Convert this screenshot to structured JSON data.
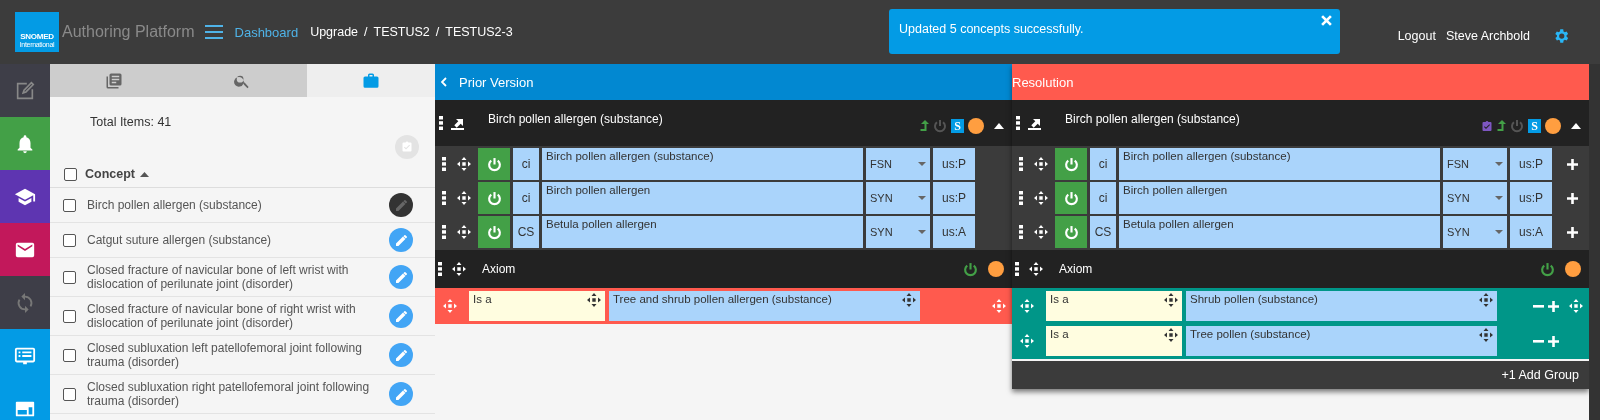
{
  "header": {
    "logo": {
      "name": "SNOMED",
      "subtitle": "International"
    },
    "app_title": "Authoring Platform",
    "nav_link": "Dashboard",
    "breadcrumb": {
      "separator": "/",
      "items": [
        "Upgrade",
        "TESTUS2",
        "TESTUS2-3"
      ]
    },
    "toast": {
      "message": "Updated 5 concepts successfully."
    },
    "logout": "Logout",
    "user": "Steve Archbold"
  },
  "side_nav": [
    {
      "kind": "edit",
      "color": "#3e3e48"
    },
    {
      "kind": "notifications",
      "color": "#43a047"
    },
    {
      "kind": "training",
      "color": "#5e35b1"
    },
    {
      "kind": "messages",
      "color": "#c2185b"
    },
    {
      "kind": "sync",
      "color": "#3e3e48"
    },
    {
      "kind": "list",
      "color": "#039be5"
    },
    {
      "kind": "layout",
      "color": "#039be5"
    }
  ],
  "left_panel": {
    "tabs": [
      {
        "kind": "documents",
        "selected": false
      },
      {
        "kind": "search",
        "selected": false
      },
      {
        "kind": "saved",
        "selected": true
      }
    ],
    "total_items": "Total Items: 41",
    "column": {
      "label": "Concept",
      "sort_ascending": true
    },
    "all_checked": false,
    "rows": [
      {
        "label": "Birch pollen allergen (substance)",
        "checked": false,
        "current": true
      },
      {
        "label": "Catgut suture allergen (substance)",
        "checked": false,
        "current": false
      },
      {
        "label": "Closed fracture of navicular bone of left wrist with dislocation of perilunate joint (disorder)",
        "checked": false,
        "current": false
      },
      {
        "label": "Closed fracture of navicular bone of right wrist with dislocation of perilunate joint (disorder)",
        "checked": false,
        "current": false
      },
      {
        "label": "Closed subluxation left patellofemoral joint following trauma (disorder)",
        "checked": false,
        "current": false
      },
      {
        "label": "Closed subluxation right patellofemoral joint following trauma (disorder)",
        "checked": false,
        "current": false
      }
    ]
  },
  "panels": [
    {
      "kind": "prior",
      "title": "Prior Version",
      "concept": {
        "name": "Birch pollen allergen (substance)",
        "icons": [
          {
            "kind": "promoted"
          },
          {
            "kind": "inactive"
          },
          {
            "kind": "semantic",
            "label": "S"
          },
          {
            "kind": "status"
          },
          {
            "kind": "collapse"
          }
        ]
      },
      "descriptions": [
        {
          "active": true,
          "case": "ci",
          "term": "Birch pollen allergen (substance)",
          "type": "FSN",
          "acceptability": "us:P",
          "editable": false
        },
        {
          "active": true,
          "case": "ci",
          "term": "Birch pollen allergen",
          "type": "SYN",
          "acceptability": "us:P",
          "editable": false
        },
        {
          "active": true,
          "case": "CS",
          "term": "Betula pollen allergen",
          "type": "SYN",
          "acceptability": "us:A",
          "editable": false
        }
      ],
      "axiom": {
        "label": "Axiom",
        "active": true,
        "groups": [
          {
            "color": "#ff5a4e",
            "drag_handle": true,
            "relationships": [
              {
                "type": "Is a",
                "target": "Tree and shrub pollen allergen (substance)",
                "editable": false
              }
            ]
          }
        ]
      }
    },
    {
      "kind": "resolution",
      "title": "Resolution",
      "concept": {
        "name": "Birch pollen allergen (substance)",
        "icons": [
          {
            "kind": "validated"
          },
          {
            "kind": "promoted"
          },
          {
            "kind": "inactive"
          },
          {
            "kind": "semantic",
            "label": "S"
          },
          {
            "kind": "status"
          },
          {
            "kind": "collapse"
          }
        ]
      },
      "descriptions": [
        {
          "active": true,
          "case": "ci",
          "term": "Birch pollen allergen (substance)",
          "type": "FSN",
          "acceptability": "us:P",
          "editable": true
        },
        {
          "active": true,
          "case": "ci",
          "term": "Birch pollen allergen",
          "type": "SYN",
          "acceptability": "us:P",
          "editable": true
        },
        {
          "active": true,
          "case": "CS",
          "term": "Betula pollen allergen",
          "type": "SYN",
          "acceptability": "us:A",
          "editable": true
        }
      ],
      "axiom": {
        "label": "Axiom",
        "active": true,
        "groups": [
          {
            "color": "#009688",
            "drag_handle": true,
            "relationships": [
              {
                "type": "Is a",
                "target": "Shrub pollen (substance)",
                "editable": true
              },
              {
                "type": "Is a",
                "target": "Tree pollen (substance)",
                "editable": true
              }
            ]
          }
        ]
      },
      "footer": "+1 Add Group"
    }
  ]
}
